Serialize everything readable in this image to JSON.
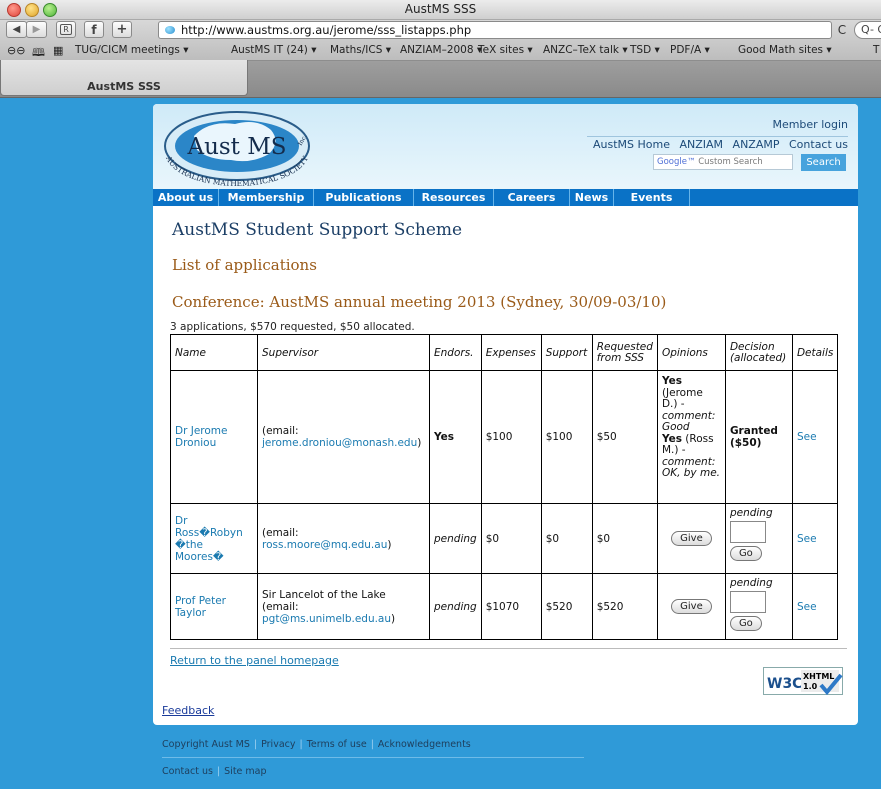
{
  "window": {
    "title": "AustMS SSS"
  },
  "toolbar": {
    "url": "http://www.austms.org.au/jerome/sss_listapps.php",
    "reload_glyph": "C",
    "search_placeholder": "Q- Goo"
  },
  "bookmarks": [
    "TUG/CICM meetings ▾",
    "AustMS IT (24) ▾",
    "Maths/ICS ▾",
    "ANZIAM–2008 ▾",
    "TeX sites ▾",
    "ANZC–TeX talk ▾",
    "TSD ▾",
    "PDF/A ▾",
    "Good Math sites ▾",
    "T"
  ],
  "tab": {
    "title": "AustMS SSS"
  },
  "site": {
    "logo_text": "Aust MS",
    "logo_ring_text": "AUSTRALIAN MATHEMATICAL SOCIETY",
    "logo_inc": "Inc.",
    "member_login": "Member login",
    "top_links": [
      "AustMS Home",
      "ANZIAM",
      "ANZAMP",
      "Contact us"
    ],
    "search_placeholder_brand": "Google™",
    "search_placeholder": "Custom Search",
    "search_button": "Search",
    "nav": [
      "About us",
      "Membership",
      "Publications",
      "Resources",
      "Careers",
      "News",
      "Events"
    ]
  },
  "page": {
    "title": "AustMS Student Support Scheme",
    "subtitle": "List of applications",
    "conference": "Conference: AustMS annual meeting 2013 (Sydney, 30/09-03/10)",
    "summary": "3 applications, $570 requested, $50 allocated."
  },
  "table": {
    "headers": {
      "name": "Name",
      "supervisor": "Supervisor",
      "endors": "Endors.",
      "expenses": "Expenses",
      "support": "Support",
      "requested": "Requested from SSS",
      "opinions": "Opinions",
      "decision": "Decision (allocated)",
      "details": "Details"
    },
    "rows": [
      {
        "name": "Dr Jerome Droniou",
        "supervisor_label": "(email:",
        "supervisor_email": "jerome.droniou@monash.edu",
        "supervisor_close": ")",
        "endors": "Yes",
        "expenses": "$100",
        "support": "$100",
        "requested": "$50",
        "opinion1_vote": "Yes",
        "opinion1_who": "(Jerome D.) -",
        "opinion1_comment": "comment: Good",
        "opinion2_vote": "Yes",
        "opinion2_who": "(Ross M.) -",
        "opinion2_comment": "comment: OK, by me.",
        "decision": "Granted ($50)",
        "details": "See"
      },
      {
        "name": "Dr Ross�Robyn �the Moores�",
        "supervisor_label": "(email:",
        "supervisor_email": "ross.moore@mq.edu.au",
        "supervisor_close": ")",
        "endors": "pending",
        "expenses": "$0",
        "support": "$0",
        "requested": "$0",
        "give_button": "Give",
        "decision": "pending",
        "go_button": "Go",
        "details": "See"
      },
      {
        "name": "Prof Peter Taylor",
        "supervisor_name": "Sir Lancelot of the Lake",
        "supervisor_label": "(email:",
        "supervisor_email": "pgt@ms.unimelb.edu.au",
        "supervisor_close": ")",
        "endors": "pending",
        "expenses": "$1070",
        "support": "$520",
        "requested": "$520",
        "give_button": "Give",
        "decision": "pending",
        "go_button": "Go",
        "details": "See"
      }
    ]
  },
  "links": {
    "return": "Return to the panel homepage",
    "feedback": "Feedback"
  },
  "badge": {
    "w3c": "W3C",
    "xhtml": "XHTML",
    "version": "1.0"
  },
  "footer": {
    "line1": [
      "Copyright Aust MS",
      "Privacy",
      "Terms of use",
      "Acknowledgements"
    ],
    "line2": [
      "Contact us",
      "Site map"
    ]
  },
  "colors": {
    "page_background": "#2f9ad8",
    "nav_bar": "#0a72c6",
    "heading": "#1c3f66",
    "subheading": "#9a5a18",
    "link": "#1a7ab0"
  }
}
